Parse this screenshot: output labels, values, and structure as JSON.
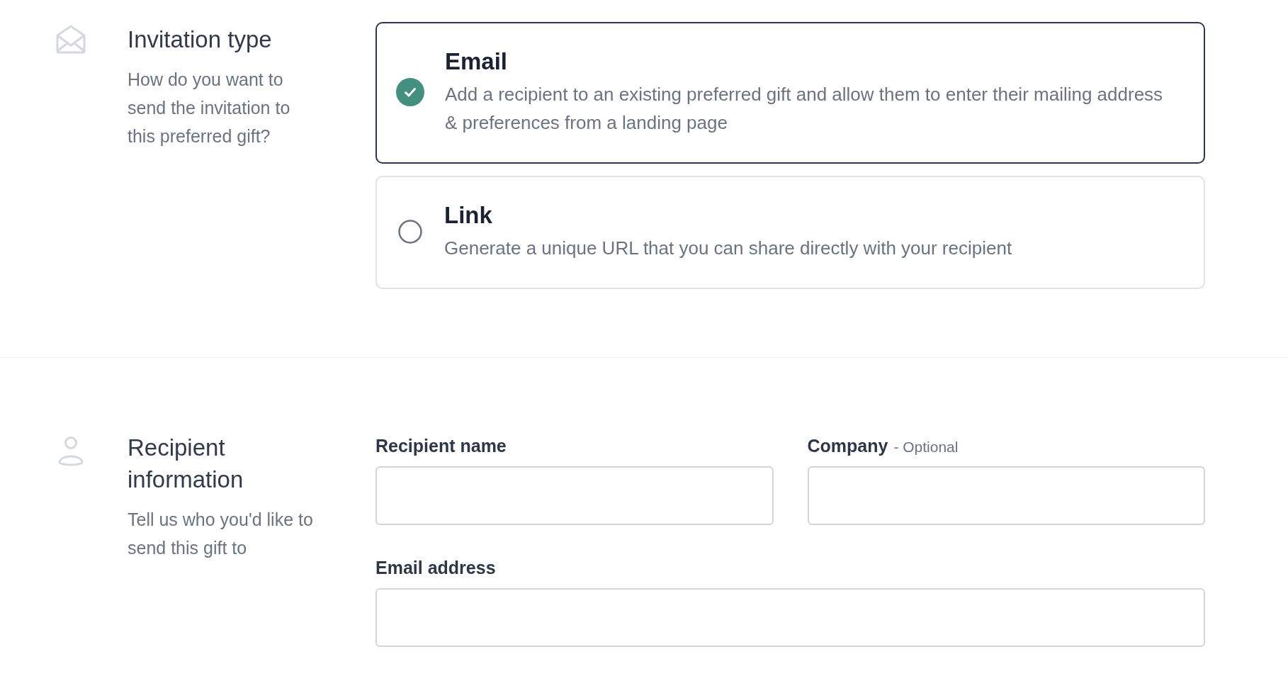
{
  "sections": [
    {
      "kind": "invitation",
      "title": "Invitation type",
      "description": "How do you want to send the invitation to this preferred gift?",
      "options": [
        {
          "title": "Email",
          "description": "Add a recipient to an existing preferred gift and allow them to enter their mailing address & preferences from a landing page",
          "selected": true
        },
        {
          "title": "Link",
          "description": "Generate a unique URL that you can share directly with your recipient",
          "selected": false
        }
      ]
    },
    {
      "kind": "recipient",
      "title": "Recipient information",
      "description": "Tell us who you'd like to send this gift to",
      "fields": [
        {
          "label": "Recipient name",
          "wide": false
        },
        {
          "label": "Company",
          "note": "- Optional",
          "wide": false
        },
        {
          "label": "Email address",
          "wide": true
        }
      ]
    }
  ]
}
